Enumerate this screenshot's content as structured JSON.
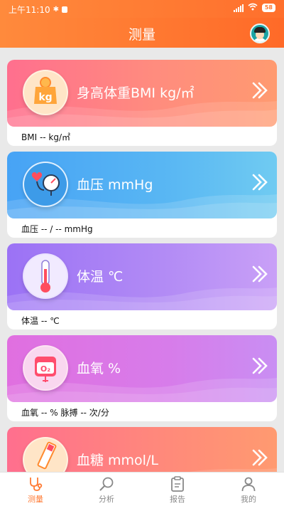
{
  "status": {
    "time": "上午11:10",
    "battery": "58"
  },
  "header": {
    "title": "测量"
  },
  "cards": [
    {
      "title": "身高体重BMI kg/㎡",
      "sub": "BMI -- kg/㎡"
    },
    {
      "title": "血压 mmHg",
      "sub": "血压 -- / -- mmHg"
    },
    {
      "title": "体温 ℃",
      "sub": "体温 -- ℃"
    },
    {
      "title": "血氧 %",
      "sub": "血氧 -- % 脉搏 -- 次/分"
    },
    {
      "title": "血糖 mmol/L",
      "sub": ""
    }
  ],
  "icons": {
    "bmi": "kg",
    "oxygen": "O₂"
  },
  "tabs": [
    {
      "label": "测量",
      "icon": "stethoscope-icon"
    },
    {
      "label": "分析",
      "icon": "magnifier-icon"
    },
    {
      "label": "报告",
      "icon": "clipboard-icon"
    },
    {
      "label": "我的",
      "icon": "person-icon"
    }
  ],
  "colors": {
    "accent": "#ff7a33",
    "inactive": "#888888"
  }
}
